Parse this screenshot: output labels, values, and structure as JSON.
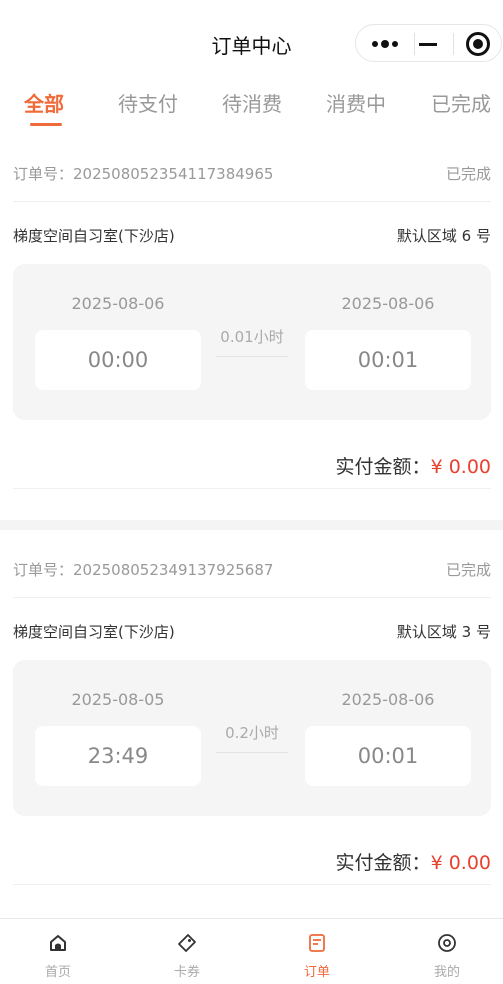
{
  "header": {
    "title": "订单中心"
  },
  "tabs": [
    {
      "label": "全部",
      "active": true
    },
    {
      "label": "待支付",
      "active": false
    },
    {
      "label": "待消费",
      "active": false
    },
    {
      "label": "消费中",
      "active": false
    },
    {
      "label": "已完成",
      "active": false
    }
  ],
  "orders": [
    {
      "order_no": "订单号：20250805235411738496­5",
      "status": "已完成",
      "store": "梯度空间自习室(下沙店)",
      "area": "默认区域 6 号",
      "start_date": "2025-08-06",
      "start_time": "00:00",
      "duration": "0.01小时",
      "end_date": "2025-08-06",
      "end_time": "00:01",
      "pay_label": "实付金额：",
      "pay_amount": "¥ 0.00"
    },
    {
      "order_no": "订单号：202508052349137925687",
      "status": "已完成",
      "store": "梯度空间自习室(下沙店)",
      "area": "默认区域 3 号",
      "start_date": "2025-08-05",
      "start_time": "23:49",
      "duration": "0.2小时",
      "end_date": "2025-08-06",
      "end_time": "00:01",
      "pay_label": "实付金额：",
      "pay_amount": "¥ 0.00"
    }
  ],
  "tabbar": [
    {
      "label": "首页",
      "icon": "home-icon",
      "active": false
    },
    {
      "label": "卡券",
      "icon": "ticket-icon",
      "active": false
    },
    {
      "label": "订单",
      "icon": "order-icon",
      "active": true
    },
    {
      "label": "我的",
      "icon": "profile-icon",
      "active": false
    }
  ],
  "colors": {
    "accent": "#f06a3a",
    "price": "#e8422f",
    "muted": "#999999",
    "card_bg": "#f5f5f5"
  }
}
